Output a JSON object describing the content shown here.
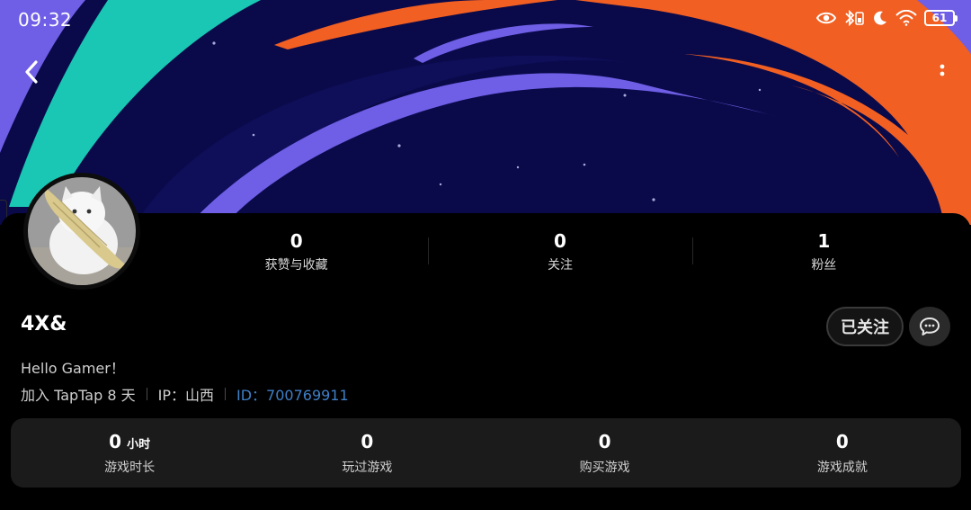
{
  "status_bar": {
    "time": "09:32",
    "battery_level": "61",
    "icons": [
      "eye-icon",
      "bluetooth-icon",
      "moon-icon",
      "wifi-icon",
      "battery-icon"
    ]
  },
  "nav": {
    "back_icon": "chevron-left-icon",
    "more_icon": "more-vertical-icon"
  },
  "profile": {
    "username": "4X&",
    "bio": "Hello Gamer！",
    "joined": "加入 TapTap 8 天",
    "ip": "IP：山西",
    "id": "ID：700769911",
    "follow_button": "已关注",
    "message_icon": "chat-bubble-icon"
  },
  "stats": [
    {
      "value": "0",
      "label": "获赞与收藏"
    },
    {
      "value": "0",
      "label": "关注"
    },
    {
      "value": "1",
      "label": "粉丝"
    }
  ],
  "game_stats": [
    {
      "value": "0",
      "unit": "小时",
      "label": "游戏时长"
    },
    {
      "value": "0",
      "unit": "",
      "label": "玩过游戏"
    },
    {
      "value": "0",
      "unit": "",
      "label": "购买游戏"
    },
    {
      "value": "0",
      "unit": "",
      "label": "游戏成就"
    }
  ],
  "colors": {
    "banner_bg": "#0a0a4a",
    "purple": "#6f5ee6",
    "teal": "#19c7b4",
    "orange": "#f25f22",
    "link_blue": "#3f7fc6",
    "card_bg": "#1b1b1b"
  }
}
